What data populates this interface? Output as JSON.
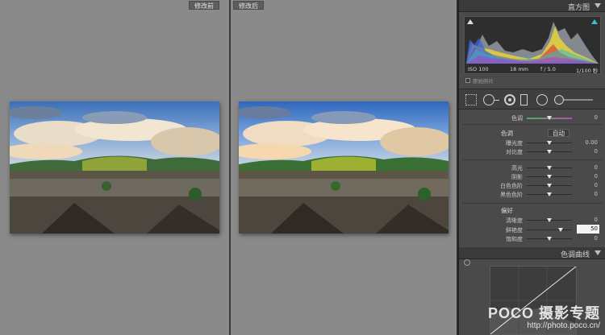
{
  "compare": {
    "before_label": "修改前",
    "after_label": "修改后"
  },
  "histogram": {
    "title": "直方图",
    "iso": "ISO 100",
    "focal": "18 mm",
    "aperture": "f / 5.0",
    "shutter": "1/100 秒",
    "original_label": "原始照片"
  },
  "basic": {
    "tint_label": "色调",
    "tint_value": "0",
    "tone_title": "色调",
    "auto_label": "自动",
    "exposure_label": "曝光度",
    "exposure_value": "0.00",
    "contrast_label": "对比度",
    "contrast_value": "0",
    "highlights_label": "高光",
    "highlights_value": "0",
    "shadows_label": "阴影",
    "shadows_value": "0",
    "whites_label": "白色色阶",
    "whites_value": "0",
    "blacks_label": "黑色色阶",
    "blacks_value": "0",
    "presence_title": "偏好",
    "clarity_label": "清晰度",
    "clarity_value": "0",
    "vibrance_label": "鲜艳度",
    "vibrance_value": "50",
    "saturation_label": "饱和度",
    "saturation_value": "0"
  },
  "slider_levels": {
    "tint": 0.5,
    "exposure": 0.5,
    "contrast": 0.5,
    "highlights": 0.5,
    "shadows": 0.5,
    "whites": 0.5,
    "blacks": 0.5,
    "clarity": 0.5,
    "vibrance": 0.75,
    "saturation": 0.5
  },
  "tone_curve": {
    "title": "色调曲线"
  },
  "watermark": {
    "brand": "POCO 摄影专题",
    "url": "http://photo.poco.cn/"
  },
  "colors": {
    "panel_bg": "#4a4a4a",
    "canvas_bg": "#8a8a8a",
    "clip_highlight": "#35c0d8"
  },
  "icons": [
    "crop-icon",
    "spot-removal-icon",
    "red-eye-icon",
    "graduated-filter-icon",
    "radial-filter-icon",
    "adjustment-brush-icon",
    "clipping-indicator-icon",
    "collapse-triangle-icon",
    "checkbox-icon"
  ]
}
